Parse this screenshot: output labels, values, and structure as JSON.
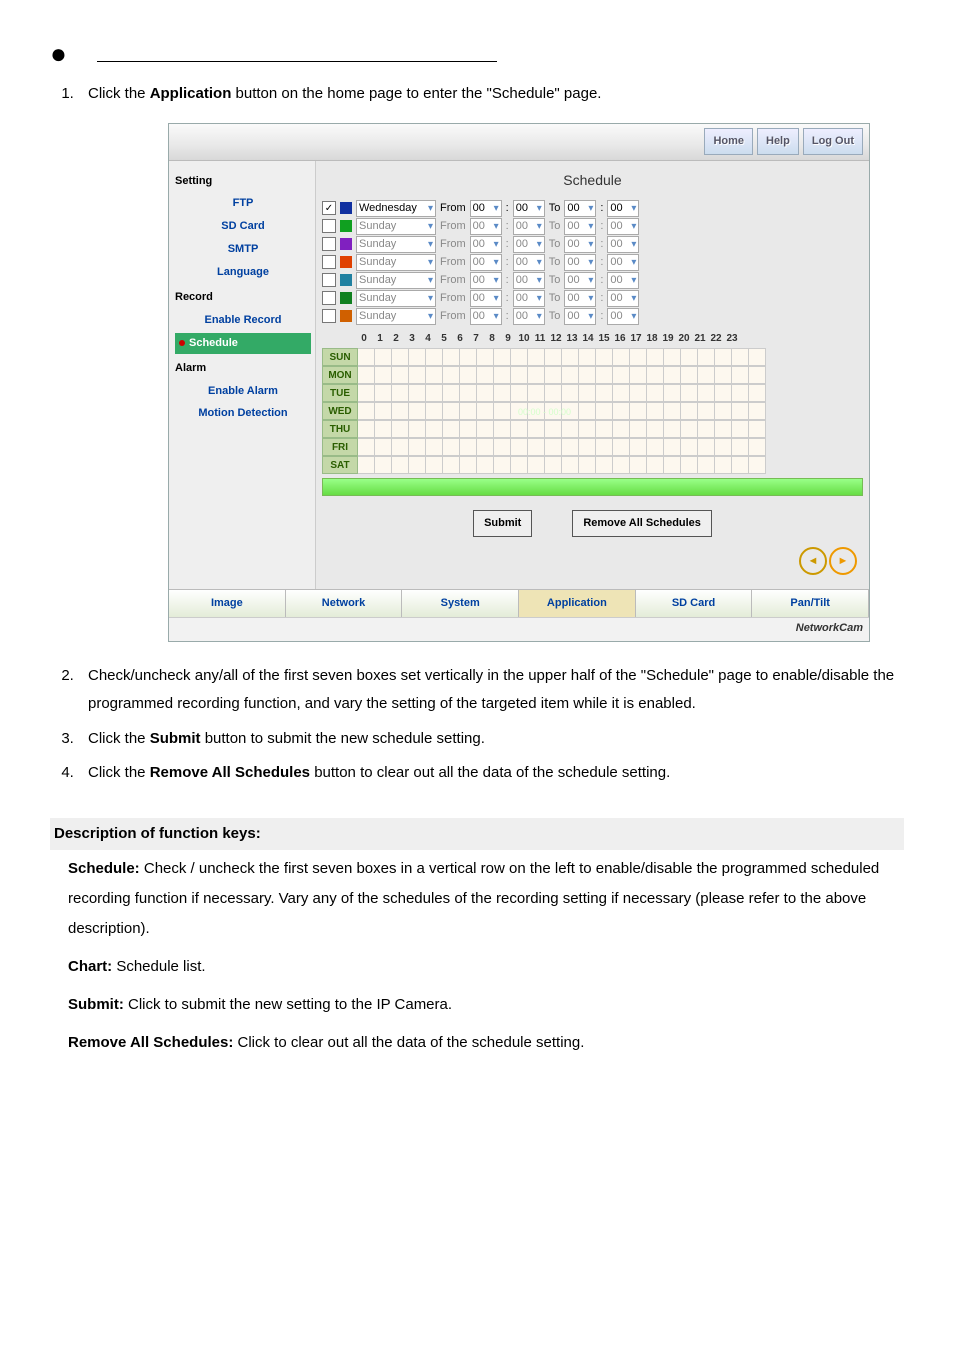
{
  "bullet_spacer": "",
  "steps": [
    {
      "pre": "Click the ",
      "bold": "Application",
      "post": " button on the home page to enter the \"Schedule\" page."
    },
    {
      "pre": "Check/uncheck any/all of the first seven boxes set vertically in the upper half of the \"Schedule\" page to enable/disable the programmed recording function, and vary the setting of the targeted item while it is enabled.",
      "bold": "",
      "post": ""
    },
    {
      "pre": "Click the ",
      "bold": "Submit",
      "post": " button to submit the new schedule setting."
    },
    {
      "pre": "Click the ",
      "bold": "Remove All Schedules",
      "post": " button to clear out all the data of the schedule setting."
    }
  ],
  "screenshot": {
    "top_links": [
      "Home",
      "Help",
      "Log Out"
    ],
    "title": "Schedule",
    "side": {
      "groups": [
        {
          "cat": "Setting",
          "items": [
            "FTP",
            "SD Card",
            "SMTP",
            "Language"
          ]
        },
        {
          "cat": "Record",
          "items": [
            "Enable Record",
            "Schedule"
          ]
        },
        {
          "cat": "Alarm",
          "items": [
            "Enable Alarm",
            "Motion Detection"
          ]
        }
      ],
      "active": "Schedule"
    },
    "rows": [
      {
        "checked": true,
        "color": "#1030a0",
        "day": "Wednesday",
        "from_h": "00",
        "from_m": "00",
        "to_h": "00",
        "to_m": "00",
        "enabled": true
      },
      {
        "checked": false,
        "color": "#10a020",
        "day": "Sunday",
        "from_h": "00",
        "from_m": "00",
        "to_h": "00",
        "to_m": "00",
        "enabled": false
      },
      {
        "checked": false,
        "color": "#8020c0",
        "day": "Sunday",
        "from_h": "00",
        "from_m": "00",
        "to_h": "00",
        "to_m": "00",
        "enabled": false
      },
      {
        "checked": false,
        "color": "#e04000",
        "day": "Sunday",
        "from_h": "00",
        "from_m": "00",
        "to_h": "00",
        "to_m": "00",
        "enabled": false
      },
      {
        "checked": false,
        "color": "#2080a0",
        "day": "Sunday",
        "from_h": "00",
        "from_m": "00",
        "to_h": "00",
        "to_m": "00",
        "enabled": false
      },
      {
        "checked": false,
        "color": "#108020",
        "day": "Sunday",
        "from_h": "00",
        "from_m": "00",
        "to_h": "00",
        "to_m": "00",
        "enabled": false
      },
      {
        "checked": false,
        "color": "#d06000",
        "day": "Sunday",
        "from_h": "00",
        "from_m": "00",
        "to_h": "00",
        "to_m": "00",
        "enabled": false
      }
    ],
    "labels": {
      "from": "From",
      "to": "To",
      "colon": ":"
    },
    "hours": [
      "0",
      "1",
      "2",
      "3",
      "4",
      "5",
      "6",
      "7",
      "8",
      "9",
      "10",
      "11",
      "12",
      "13",
      "14",
      "15",
      "16",
      "17",
      "18",
      "19",
      "20",
      "21",
      "22",
      "23"
    ],
    "days": [
      "SUN",
      "MON",
      "TUE",
      "WED",
      "THU",
      "FRI",
      "SAT"
    ],
    "wed_label": "00:00 - 00:00",
    "buttons": {
      "submit": "Submit",
      "remove": "Remove All Schedules"
    },
    "tabs": [
      "Image",
      "Network",
      "System",
      "Application",
      "SD Card",
      "Pan/Tilt"
    ],
    "active_tab": "Application",
    "brand": "NetworkCam"
  },
  "desc": {
    "heading": "Description of function keys:",
    "items": [
      {
        "k": "Schedule:",
        "v": " Check / uncheck the first seven boxes in a vertical row on the left to enable/disable the programmed scheduled recording function if necessary. Vary any of the schedules of the recording setting if necessary (please refer to the above description)."
      },
      {
        "k": "Chart:",
        "v": " Schedule list."
      },
      {
        "k": "Submit:",
        "v": " Click to submit the new setting to the IP Camera."
      },
      {
        "k": "Remove All Schedules:",
        "v": " Click to clear out all the data of the schedule setting."
      }
    ]
  }
}
